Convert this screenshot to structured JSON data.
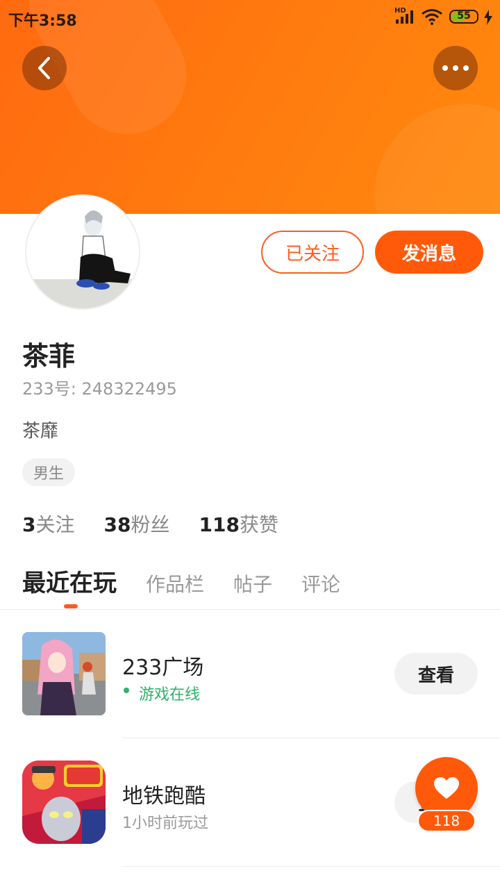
{
  "status_bar": {
    "time": "下午3:58",
    "network": "HD",
    "battery": "55",
    "battery_level": 0.55
  },
  "colors": {
    "accent": "#ff5a0a",
    "header_start": "#ff6a10",
    "header_end": "#ff8a0e",
    "online": "#2bb36a"
  },
  "nav": {
    "back_icon": "chevron-left-icon",
    "more_icon": "more-dots-icon"
  },
  "actions": {
    "followed_label": "已关注",
    "message_label": "发消息"
  },
  "profile": {
    "name": "茶菲",
    "uid": "233号: 248322495",
    "bio": "茶靡",
    "gender_tag": "男生"
  },
  "stats": [
    {
      "count": "3",
      "label": "关注"
    },
    {
      "count": "38",
      "label": "粉丝"
    },
    {
      "count": "118",
      "label": "获赞"
    }
  ],
  "tabs": [
    "最近在玩",
    "作品栏",
    "帖子",
    "评论"
  ],
  "games": [
    {
      "title": "233广场",
      "status": "游戏在线",
      "button": "查看"
    },
    {
      "title": "地铁跑酷",
      "status": "1小时前玩过",
      "button": "查看"
    }
  ],
  "like": {
    "icon": "heart-icon",
    "count": "118"
  }
}
